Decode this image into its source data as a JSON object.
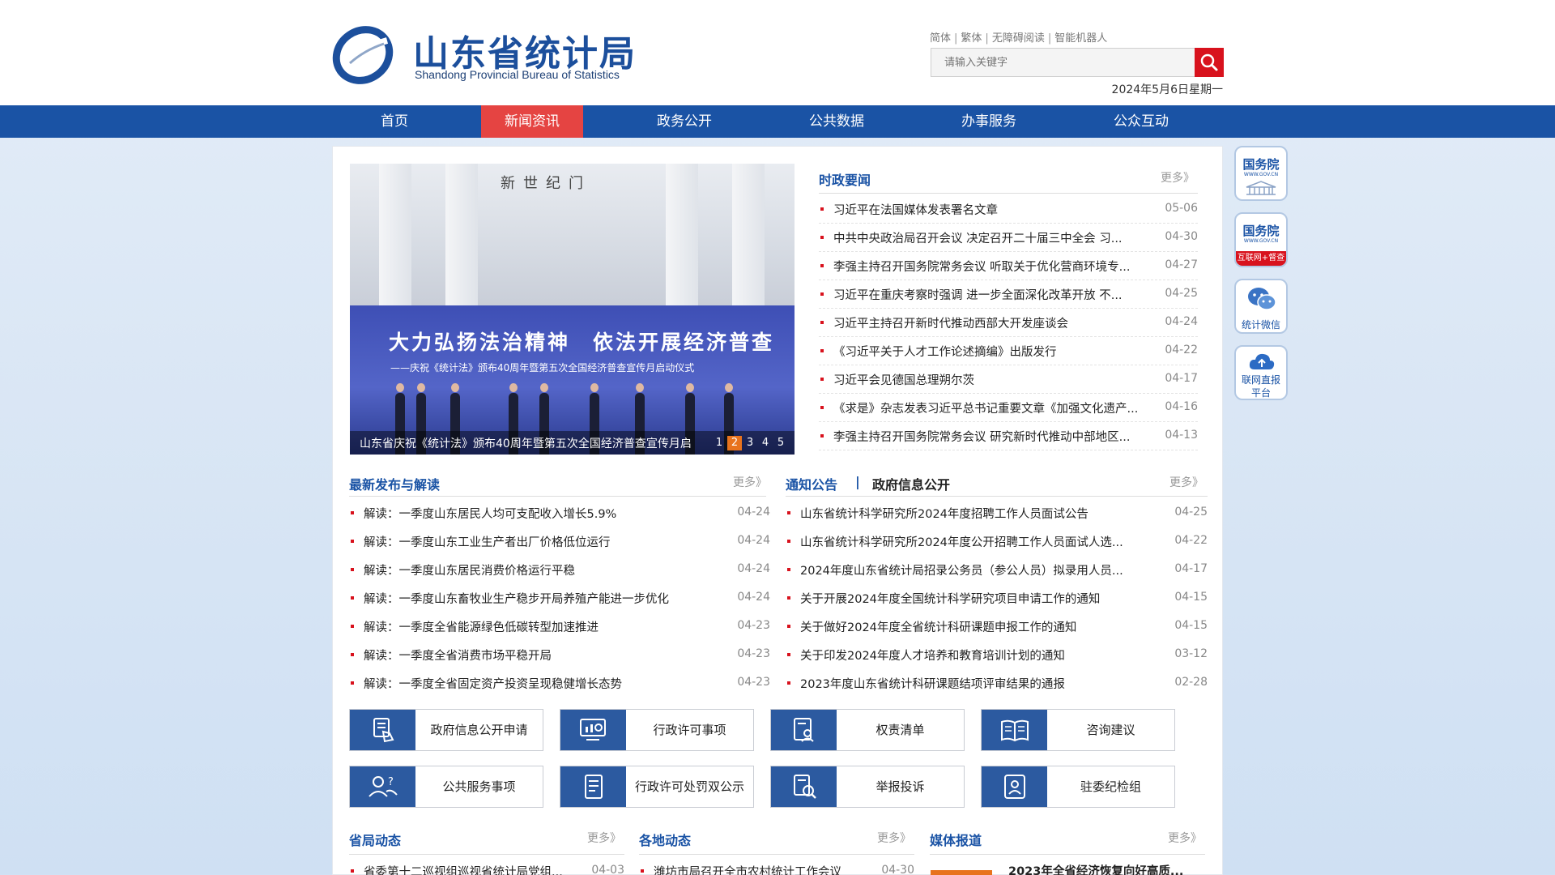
{
  "site": {
    "title_cn": "山东省统计局",
    "title_en": "Shandong Provincial Bureau of Statistics"
  },
  "top_links": [
    "简体",
    "繁体",
    "无障碍阅读",
    "智能机器人"
  ],
  "search": {
    "placeholder": "请输入关键字"
  },
  "date": "2024年5月6日星期一",
  "nav": {
    "items": [
      "首页",
      "新闻资讯",
      "政务公开",
      "公共数据",
      "办事服务",
      "公众互动"
    ],
    "active": "新闻资讯"
  },
  "slider": {
    "gate_text": "新世纪门",
    "banner_title": "大力弘扬法治精神　依法开展经济普查",
    "banner_sub": "——庆祝《统计法》颁布40周年暨第五次全国经济普查宣传月启动仪式",
    "caption": "山东省庆祝《统计法》颁布40周年暨第五次全国经济普查宣传月启",
    "pages": [
      "1",
      "2",
      "3",
      "4",
      "5"
    ],
    "active_page": "2"
  },
  "politics_news": {
    "title": "时政要闻",
    "more": "更多》",
    "items": [
      {
        "title": "习近平在法国媒体发表署名文章",
        "date": "05-06"
      },
      {
        "title": "中共中央政治局召开会议 决定召开二十届三中全会 习...",
        "date": "04-30"
      },
      {
        "title": "李强主持召开国务院常务会议 听取关于优化营商环境专...",
        "date": "04-27"
      },
      {
        "title": "习近平在重庆考察时强调 进一步全面深化改革开放 不...",
        "date": "04-25"
      },
      {
        "title": "习近平主持召开新时代推动西部大开发座谈会",
        "date": "04-24"
      },
      {
        "title": "《习近平关于人才工作论述摘编》出版发行",
        "date": "04-22"
      },
      {
        "title": "习近平会见德国总理朔尔茨",
        "date": "04-17"
      },
      {
        "title": "《求是》杂志发表习近平总书记重要文章《加强文化遗产...",
        "date": "04-16"
      },
      {
        "title": "李强主持召开国务院常务会议 研究新时代推动中部地区...",
        "date": "04-13"
      }
    ]
  },
  "releases": {
    "title": "最新发布与解读",
    "more": "更多》",
    "items": [
      {
        "title": "解读：一季度山东居民人均可支配收入增长5.9%",
        "date": "04-24"
      },
      {
        "title": "解读：一季度山东工业生产者出厂价格低位运行",
        "date": "04-24"
      },
      {
        "title": "解读：一季度山东居民消费价格运行平稳",
        "date": "04-24"
      },
      {
        "title": "解读：一季度山东畜牧业生产稳步开局养殖产能进一步优化",
        "date": "04-24"
      },
      {
        "title": "解读：一季度全省能源绿色低碳转型加速推进",
        "date": "04-23"
      },
      {
        "title": "解读：一季度全省消费市场平稳开局",
        "date": "04-23"
      },
      {
        "title": "解读：一季度全省固定资产投资呈现稳健增长态势",
        "date": "04-23"
      }
    ]
  },
  "notices": {
    "tab1": "通知公告",
    "tab_sep": "|",
    "tab2": "政府信息公开",
    "more": "更多》",
    "items": [
      {
        "title": "山东省统计科学研究所2024年度招聘工作人员面试公告",
        "date": "04-25"
      },
      {
        "title": "山东省统计科学研究所2024年度公开招聘工作人员面试人选...",
        "date": "04-22"
      },
      {
        "title": "2024年度山东省统计局招录公务员（参公人员）拟录用人员...",
        "date": "04-17"
      },
      {
        "title": "关于开展2024年度全国统计科学研究项目申请工作的通知",
        "date": "04-15"
      },
      {
        "title": "关于做好2024年度全省统计科研课题申报工作的通知",
        "date": "04-15"
      },
      {
        "title": "关于印发2024年度人才培养和教育培训计划的通知",
        "date": "03-12"
      },
      {
        "title": "2023年度山东省统计科研课题结项评审结果的通报",
        "date": "02-28"
      }
    ]
  },
  "services": [
    {
      "label": "政府信息公开申请",
      "icon": "hand-document-icon"
    },
    {
      "label": "行政许可事项",
      "icon": "chart-search-icon"
    },
    {
      "label": "权责清单",
      "icon": "person-document-icon"
    },
    {
      "label": "咨询建议",
      "icon": "open-book-icon"
    },
    {
      "label": "公共服务事项",
      "icon": "users-question-icon"
    },
    {
      "label": "行政许可处罚双公示",
      "icon": "document-list-icon"
    },
    {
      "label": "举报投诉",
      "icon": "document-search-icon"
    },
    {
      "label": "驻委纪检组",
      "icon": "badge-person-icon"
    }
  ],
  "bottom": {
    "col1": {
      "title": "省局动态",
      "more": "更多》",
      "first": "省委第十二巡视组巡视省统计局党组...",
      "date": "04-03"
    },
    "col2": {
      "title": "各地动态",
      "more": "更多》",
      "first": "潍坊市局召开全市农村统计工作会议",
      "date": "04-30"
    },
    "col3": {
      "title": "媒体报道",
      "more": "更多》",
      "first": "2023年全省经济恢复向好高质..."
    }
  },
  "side": {
    "gov1": {
      "big": "国务院",
      "mini": "WWW.GOV.CN"
    },
    "gov2": {
      "big": "国务院",
      "mini": "WWW.GOV.CN",
      "bar": "互联网+督查"
    },
    "wechat": "统计微信",
    "report": [
      "联网直报",
      "平台"
    ]
  },
  "colors": {
    "brand_blue": "#1a53a5",
    "accent_red": "#e54442",
    "search_red": "#d8121d",
    "active_dot": "#e8731d"
  }
}
